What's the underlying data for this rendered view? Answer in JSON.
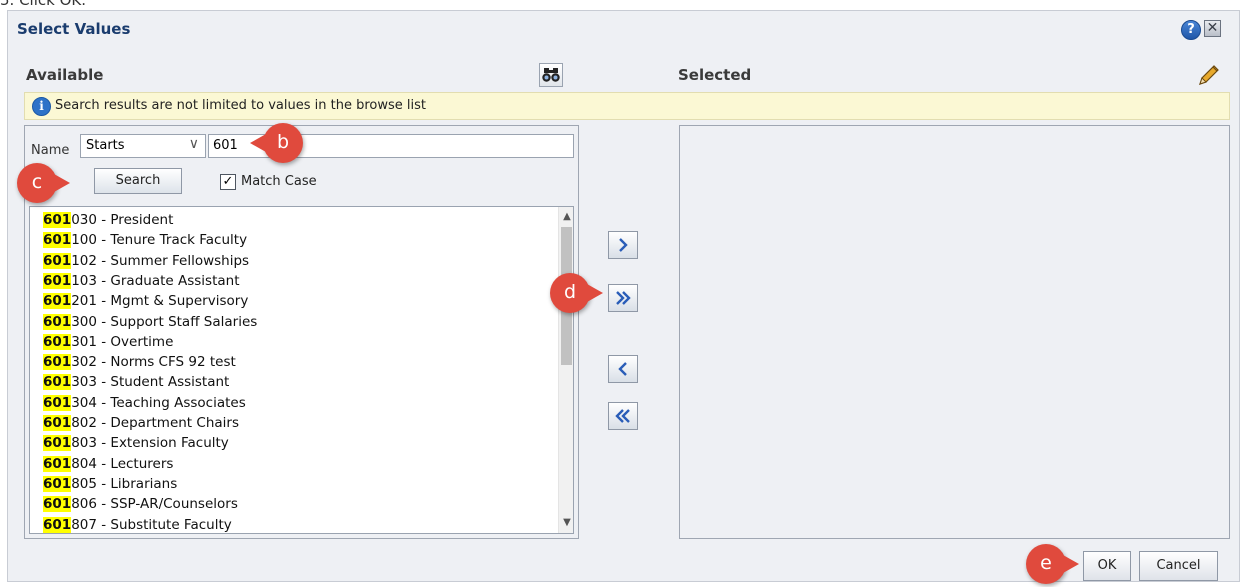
{
  "step_text": "5.   Click OK.",
  "dialog": {
    "title": "Select Values",
    "help_icon": "?",
    "close_icon": "✕"
  },
  "available": {
    "label": "Available",
    "name_label": "Name",
    "operator": "Starts",
    "search_value": "601",
    "search_button": "Search",
    "match_case_label": "Match Case",
    "match_case_checked": true
  },
  "info_bar": {
    "text": "Search results are not limited to values in the browse list"
  },
  "results": [
    {
      "match": "601",
      "rest": "030 - President"
    },
    {
      "match": "601",
      "rest": "100 - Tenure Track Faculty"
    },
    {
      "match": "601",
      "rest": "102 - Summer Fellowships"
    },
    {
      "match": "601",
      "rest": "103 - Graduate Assistant"
    },
    {
      "match": "601",
      "rest": "201 - Mgmt & Supervisory"
    },
    {
      "match": "601",
      "rest": "300 - Support Staff Salaries"
    },
    {
      "match": "601",
      "rest": "301 - Overtime"
    },
    {
      "match": "601",
      "rest": "302 - Norms CFS 92 test"
    },
    {
      "match": "601",
      "rest": "303 - Student Assistant"
    },
    {
      "match": "601",
      "rest": "304 - Teaching Associates"
    },
    {
      "match": "601",
      "rest": "802 - Department Chairs"
    },
    {
      "match": "601",
      "rest": "803 - Extension Faculty"
    },
    {
      "match": "601",
      "rest": "804 - Lecturers"
    },
    {
      "match": "601",
      "rest": "805 - Librarians"
    },
    {
      "match": "601",
      "rest": "806 - SSP-AR/Counselors"
    },
    {
      "match": "601",
      "rest": "807 - Substitute Faculty"
    }
  ],
  "selected": {
    "label": "Selected"
  },
  "buttons": {
    "ok": "OK",
    "cancel": "Cancel"
  },
  "callouts": {
    "b": "b",
    "c": "c",
    "d": "d",
    "e": "e"
  },
  "icons": {
    "binoculars": "binoculars-icon",
    "pencil": "pencil-icon",
    "move_right": "chevron-right-icon",
    "move_all_right": "double-chevron-right-icon",
    "move_left": "chevron-left-icon",
    "move_all_left": "double-chevron-left-icon"
  },
  "colors": {
    "title_blue": "#1a3c6e",
    "highlight": "#ffff00",
    "callout_red": "#e04a3d",
    "info_bar": "#fbf8d4"
  }
}
